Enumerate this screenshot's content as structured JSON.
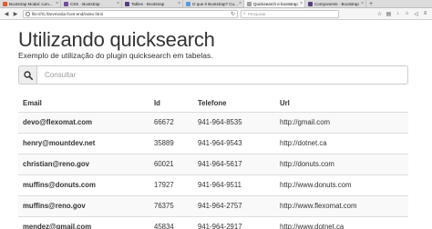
{
  "browser": {
    "tabs": [
      {
        "label": "Bootstrap Modal: com...",
        "color": "#e45a30",
        "active": false
      },
      {
        "label": "CSS · Bootstrap",
        "color": "#6f4a9d",
        "active": false
      },
      {
        "label": "Tables · Bootstrap",
        "color": "#563d7c",
        "active": false
      },
      {
        "label": "O que é Bootstrap? Cu...",
        "color": "#5b9bd5",
        "active": false
      },
      {
        "label": "Quicksearch e bootstrap",
        "color": "#9e9e9e",
        "active": true
      },
      {
        "label": "Components · Bootstrap",
        "color": "#563d7c",
        "active": false
      }
    ],
    "url": "file:///G:/Devmedia front-end/index.html",
    "search_placeholder": "Pesquisar"
  },
  "page": {
    "title": "Utilizando quicksearch",
    "subtitle": "Exemplo de utilização do plugin quicksearch em tabelas.",
    "search": {
      "placeholder": "Consultar",
      "value": ""
    },
    "table": {
      "headers": {
        "email": "Email",
        "id": "Id",
        "telefone": "Telefone",
        "url": "Url"
      },
      "rows": [
        {
          "email": "devo@flexomat.com",
          "id": "66672",
          "telefone": "941-964-8535",
          "url": "http://gmail.com"
        },
        {
          "email": "henry@mountdev.net",
          "id": "35889",
          "telefone": "941-964-9543",
          "url": "http://dotnet.ca"
        },
        {
          "email": "christian@reno.gov",
          "id": "60021",
          "telefone": "941-964-5617",
          "url": "http://donuts.com"
        },
        {
          "email": "muffins@donuts.com",
          "id": "17927",
          "telefone": "941-964-9511",
          "url": "http://www.donuts.com"
        },
        {
          "email": "muffins@reno.gov",
          "id": "76375",
          "telefone": "941-964-2757",
          "url": "http://www.flexomat.com"
        },
        {
          "email": "mendez@gmail.com",
          "id": "45834",
          "telefone": "941-964-2917",
          "url": "http://www.dotnet.ca"
        }
      ]
    }
  }
}
